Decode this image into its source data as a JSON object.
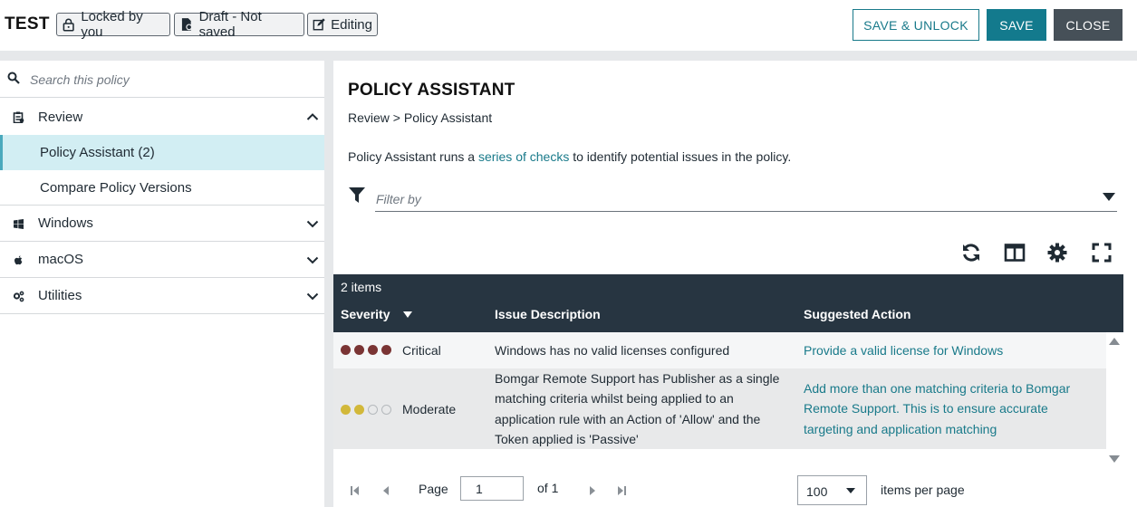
{
  "header": {
    "title": "TEST",
    "chips": {
      "locked": "Locked by you",
      "draft": "Draft - Not saved",
      "editing": "Editing"
    },
    "buttons": {
      "save_unlock": "SAVE & UNLOCK",
      "save": "SAVE",
      "close": "CLOSE"
    }
  },
  "sidebar": {
    "search_placeholder": "Search this policy",
    "review": {
      "label": "Review",
      "items": [
        "Policy Assistant (2)",
        "Compare Policy Versions"
      ]
    },
    "sections": [
      "Windows",
      "macOS",
      "Utilities"
    ]
  },
  "main": {
    "title": "POLICY ASSISTANT",
    "breadcrumb": "Review > Policy Assistant",
    "description": {
      "before": "Policy Assistant runs a ",
      "link": "series of checks",
      "after": " to identify potential issues in the policy."
    },
    "filter_placeholder": "Filter by",
    "grid": {
      "count": "2 items",
      "columns": [
        "Severity",
        "Issue Description",
        "Suggested Action"
      ],
      "rows": [
        {
          "severity": "Critical",
          "level": 4,
          "issue": "Windows has no valid licenses configured",
          "action": "Provide a valid license for Windows"
        },
        {
          "severity": "Moderate",
          "level": 2,
          "issue": "Bomgar Remote Support has Publisher as a single matching criteria whilst being applied to an application rule with an Action of 'Allow' and the Token applied is 'Passive'",
          "action": "Add more than one matching criteria to Bomgar Remote Support. This is to ensure accurate targeting and application matching"
        }
      ]
    },
    "pager": {
      "page_label": "Page",
      "page_value": "1",
      "of_label": "of 1",
      "per_page_value": "100",
      "per_page_label": "items per page"
    }
  },
  "colors": {
    "accent": "#197a8a",
    "critical_dot": "#7a3434",
    "moderate_dot": "#d2b83a",
    "grid_header": "#273541"
  }
}
